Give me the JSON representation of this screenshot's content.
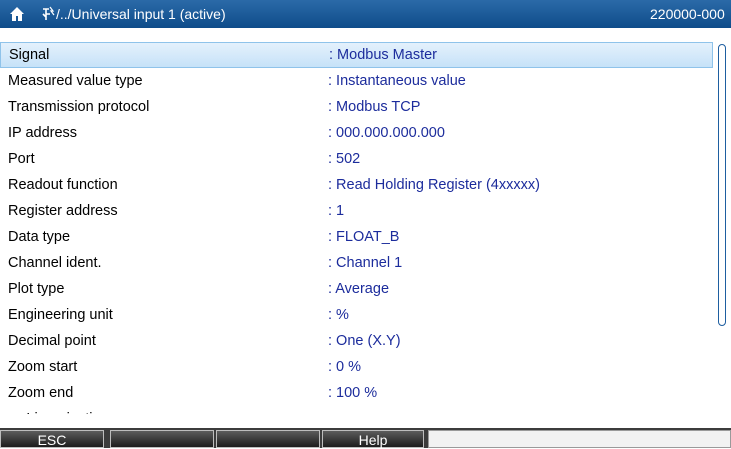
{
  "titlebar": {
    "path": "/../Universal input 1 (active)",
    "right_text": "220000-000"
  },
  "rows": [
    {
      "label": "Signal",
      "value": ": Modbus Master"
    },
    {
      "label": "Measured value type",
      "value": ": Instantaneous value"
    },
    {
      "label": "Transmission protocol",
      "value": ": Modbus TCP"
    },
    {
      "label": "IP address",
      "value": ": 000.000.000.000"
    },
    {
      "label": "Port",
      "value": ": 502"
    },
    {
      "label": "Readout function",
      "value": ": Read Holding Register (4xxxxx)"
    },
    {
      "label": "Register address",
      "value": ": 1"
    },
    {
      "label": "Data type",
      "value": ": FLOAT_B"
    },
    {
      "label": "Channel ident.",
      "value": ": Channel 1"
    },
    {
      "label": "Plot type",
      "value": ": Average"
    },
    {
      "label": "Engineering unit",
      "value": ": %"
    },
    {
      "label": "Decimal point",
      "value": ": One (X.Y)"
    },
    {
      "label": "Zoom start",
      "value": ": 0 %"
    },
    {
      "label": "Zoom end",
      "value": ": 100 %"
    }
  ],
  "partial_row": "► Linearization",
  "softkeys": [
    "ESC",
    "",
    "",
    "Help",
    ""
  ],
  "colors": {
    "titlebar": "#0f4c8a",
    "value_text": "#1c2c9c",
    "selection": "#c6e2f8"
  }
}
